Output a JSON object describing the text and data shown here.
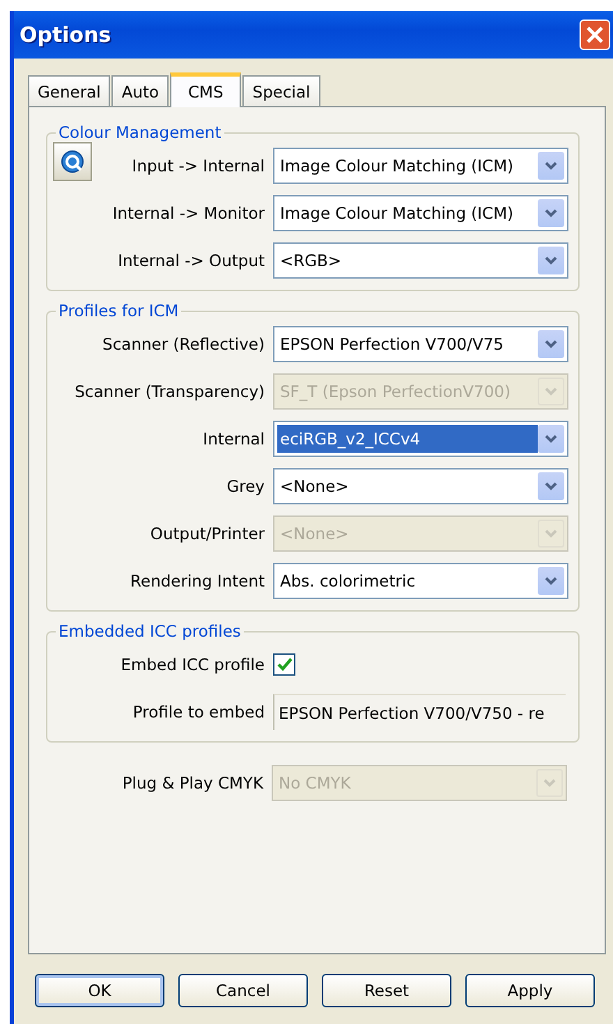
{
  "window": {
    "title": "Options"
  },
  "tabs": [
    {
      "label": "General",
      "selected": false
    },
    {
      "label": "Auto",
      "selected": false
    },
    {
      "label": "CMS",
      "selected": true
    },
    {
      "label": "Special",
      "selected": false
    }
  ],
  "groups": [
    {
      "title": "Colour Management",
      "tool_button": true,
      "rows": [
        {
          "kind": "combo",
          "label": "Input -> Internal",
          "value": "Image Colour Matching (ICM)",
          "disabled": false,
          "highlighted": false
        },
        {
          "kind": "combo",
          "label": "Internal -> Monitor",
          "value": "Image Colour Matching (ICM)",
          "disabled": false,
          "highlighted": false
        },
        {
          "kind": "combo",
          "label": "Internal -> Output",
          "value": "<RGB>",
          "disabled": false,
          "highlighted": false
        }
      ]
    },
    {
      "title": "Profiles for ICM",
      "tool_button": false,
      "rows": [
        {
          "kind": "combo",
          "label": "Scanner (Reflective)",
          "value": "EPSON Perfection V700/V75",
          "disabled": false,
          "highlighted": false
        },
        {
          "kind": "combo",
          "label": "Scanner (Transparency)",
          "value": "SF_T (Epson PerfectionV700)",
          "disabled": true,
          "highlighted": false
        },
        {
          "kind": "combo",
          "label": "Internal",
          "value": "eciRGB_v2_ICCv4",
          "disabled": false,
          "highlighted": true
        },
        {
          "kind": "combo",
          "label": "Grey",
          "value": "<None>",
          "disabled": false,
          "highlighted": false
        },
        {
          "kind": "combo",
          "label": "Output/Printer",
          "value": "<None>",
          "disabled": true,
          "highlighted": false
        },
        {
          "kind": "combo",
          "label": "Rendering Intent",
          "value": "Abs. colorimetric",
          "disabled": false,
          "highlighted": false
        }
      ]
    },
    {
      "title": "Embedded ICC profiles",
      "tool_button": false,
      "rows": [
        {
          "kind": "checkbox",
          "label": "Embed ICC profile",
          "checked": true
        },
        {
          "kind": "text",
          "label": "Profile to embed",
          "value": "EPSON Perfection V700/V750 - re"
        }
      ]
    }
  ],
  "rows": [
    {
      "kind": "combo",
      "label": "Plug & Play CMYK",
      "value": "No CMYK",
      "disabled": true,
      "highlighted": false
    }
  ],
  "buttons": [
    {
      "label": "OK",
      "default": true
    },
    {
      "label": "Cancel",
      "default": false
    },
    {
      "label": "Reset",
      "default": false
    },
    {
      "label": "Apply",
      "default": false
    }
  ]
}
